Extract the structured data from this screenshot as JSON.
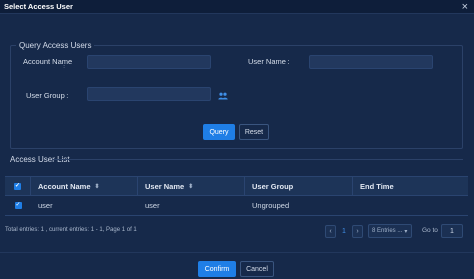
{
  "dialog": {
    "title": "Select Access User",
    "close_glyph": "×"
  },
  "query": {
    "legend": "Query Access Users",
    "account_name_label": "Account Name",
    "account_name_colon": " :",
    "user_name_label": "User Name :",
    "user_group_label": "User Group :",
    "account_name_value": "",
    "user_name_value": "",
    "user_group_value": "",
    "user_group_icon": "user-group-icon",
    "query_button": "Query",
    "reset_button": "Reset"
  },
  "list": {
    "title": "Access User List",
    "columns": [
      "Account Name",
      "User Name",
      "User Group",
      "End Time"
    ],
    "sort_glyph": "⬍",
    "rows": [
      {
        "checked": true,
        "account_name": "user",
        "user_name": "user",
        "user_group": "Ungrouped",
        "end_time": ""
      }
    ],
    "check_glyph": "✓"
  },
  "pagination": {
    "summary": "Total entries: 1 , current entries: 1 - 1, Page 1 of 1",
    "prev_glyph": "‹",
    "current_page": "1",
    "next_glyph": "›",
    "per_page": "8 Entries ...",
    "per_page_caret": "▾",
    "goto_label": "Go to",
    "goto_value": "1"
  },
  "footer": {
    "confirm_button": "Confirm",
    "cancel_button": "Cancel"
  },
  "colors": {
    "background": "#16294a",
    "primary": "#1f7ee6",
    "border": "#2a4470"
  }
}
